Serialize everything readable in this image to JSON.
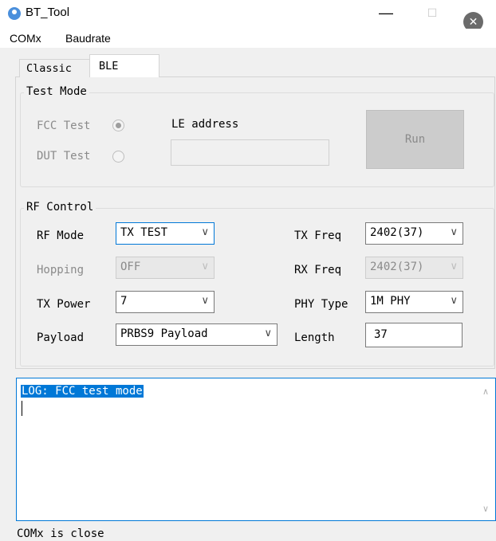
{
  "window": {
    "title": "BT_Tool",
    "icons": [
      "app-icon",
      "minimize-icon",
      "maximize-icon",
      "close-icon"
    ]
  },
  "menu": {
    "items": [
      "COMx",
      "Baudrate"
    ]
  },
  "tabs": [
    {
      "label": "Classic"
    },
    {
      "label": "BLE"
    }
  ],
  "test_mode": {
    "title": "Test Mode",
    "fcc_label": "FCC Test",
    "dut_label": "DUT Test",
    "le_address_label": "LE address",
    "le_address_value": "",
    "run_label": "Run"
  },
  "rf_control": {
    "title": "RF Control",
    "rf_mode": {
      "label": "RF Mode",
      "value": "TX TEST"
    },
    "hopping": {
      "label": "Hopping",
      "value": "OFF"
    },
    "tx_power": {
      "label": "TX Power",
      "value": "7"
    },
    "payload": {
      "label": "Payload",
      "value": "PRBS9 Payload"
    },
    "tx_freq": {
      "label": "TX Freq",
      "value": "2402(37)"
    },
    "rx_freq": {
      "label": "RX Freq",
      "value": "2402(37)"
    },
    "phy_type": {
      "label": "PHY Type",
      "value": "1M PHY"
    },
    "length": {
      "label": "Length",
      "value": "37"
    }
  },
  "log": {
    "text": "LOG: FCC test mode"
  },
  "status": {
    "text": "COMx is close"
  },
  "colors": {
    "accent": "#0078d7",
    "disabled_text": "#8a8a8a"
  }
}
